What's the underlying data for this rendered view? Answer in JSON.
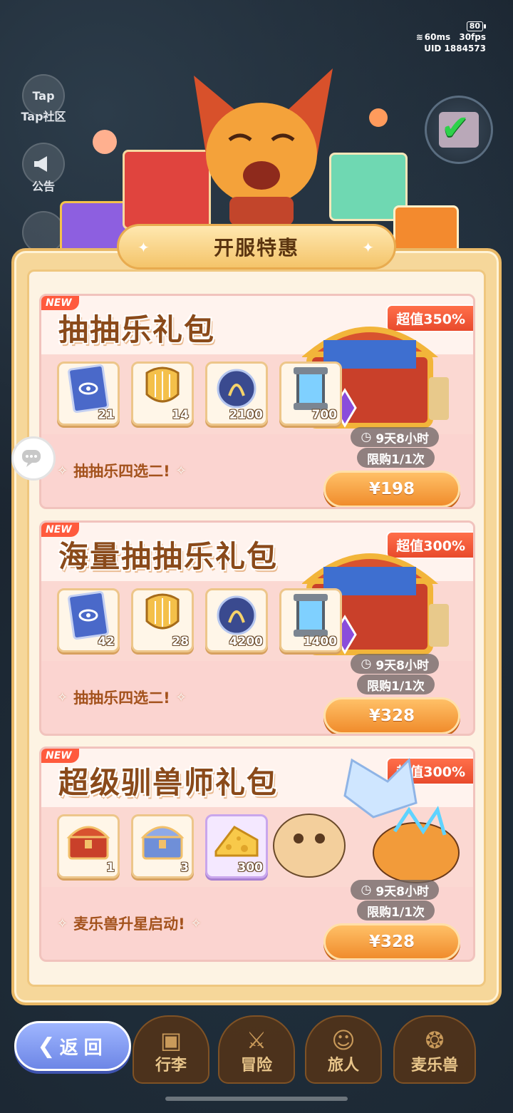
{
  "status": {
    "battery": "80",
    "ping": "60ms",
    "fps": "30fps",
    "uid": "UID 1884573"
  },
  "side": {
    "tap_logo": "Tap",
    "tap_label": "Tap社区",
    "notice_label": "公告"
  },
  "panel": {
    "title": "开服特惠"
  },
  "packs": [
    {
      "badge": "NEW",
      "title": "抽抽乐礼包",
      "value_tag": "超值350%",
      "items": [
        {
          "icon": "eye-card-icon",
          "count": "21"
        },
        {
          "icon": "harp-icon",
          "count": "14"
        },
        {
          "icon": "orb-icon",
          "count": "2100"
        },
        {
          "icon": "canister-icon",
          "count": "700"
        }
      ],
      "timer": "9天8小时",
      "limit": "限购1/1次",
      "promo": "抽抽乐四选二!",
      "price": "¥198"
    },
    {
      "badge": "NEW",
      "title": "海量抽抽乐礼包",
      "value_tag": "超值300%",
      "items": [
        {
          "icon": "eye-card-icon",
          "count": "42"
        },
        {
          "icon": "harp-icon",
          "count": "28"
        },
        {
          "icon": "orb-icon",
          "count": "4200"
        },
        {
          "icon": "canister-icon",
          "count": "1400"
        }
      ],
      "timer": "9天8小时",
      "limit": "限购1/1次",
      "promo": "抽抽乐四选二!",
      "price": "¥328"
    },
    {
      "badge": "NEW",
      "title": "超级驯兽师礼包",
      "value_tag": "超值300%",
      "items": [
        {
          "icon": "red-chest-icon",
          "count": "1"
        },
        {
          "icon": "blue-chest-icon",
          "count": "3"
        },
        {
          "icon": "cheese-icon",
          "count": "300"
        }
      ],
      "timer": "9天8小时",
      "limit": "限购1/1次",
      "promo": "麦乐兽升星启动!",
      "price": "¥328"
    }
  ],
  "nav": {
    "back": "返回",
    "bag": "行李",
    "adventure": "冒险",
    "traveler": "旅人",
    "beast": "麦乐兽"
  },
  "colors": {
    "accent_orange": "#f08c2c",
    "value_red": "#e84a2c",
    "panel_gold": "#f6d79a",
    "card_pink": "#fbd4d0"
  }
}
